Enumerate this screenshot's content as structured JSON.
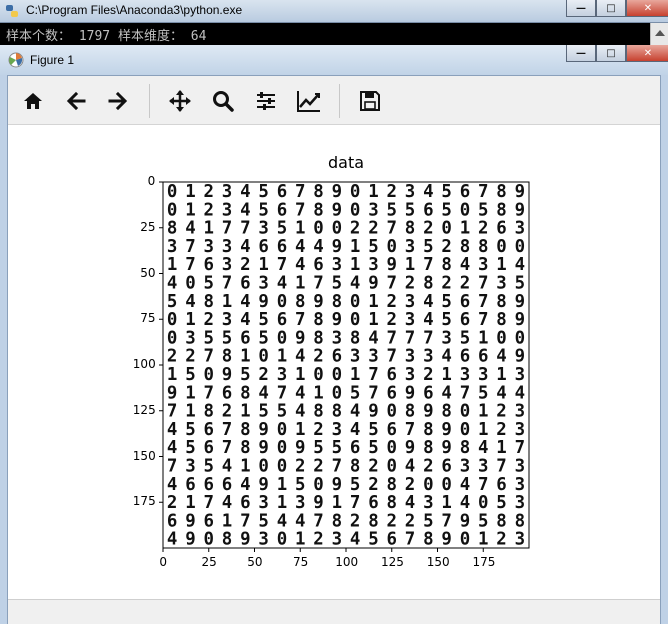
{
  "console": {
    "title": "C:\\Program Files\\Anaconda3\\python.exe",
    "output_line": "样本个数： 1797 样本维度： 64",
    "minimize": "—",
    "maximize": "□",
    "close": "✕"
  },
  "figure": {
    "title": "Figure 1",
    "minimize": "—",
    "maximize": "□",
    "close": "✕",
    "toolbar": [
      "home-icon",
      "back-icon",
      "forward-icon",
      "pan-icon",
      "zoom-icon",
      "configure-subplots-icon",
      "edit-axis-icon",
      "save-icon"
    ]
  },
  "chart_data": {
    "type": "heatmap",
    "title": "data",
    "xlabel": "",
    "ylabel": "",
    "xlim": [
      0,
      200
    ],
    "ylim": [
      200,
      0
    ],
    "xticks": [
      "0",
      "25",
      "50",
      "75",
      "100",
      "125",
      "150",
      "175"
    ],
    "yticks": [
      "0",
      "25",
      "50",
      "75",
      "100",
      "125",
      "150",
      "175"
    ],
    "grid": false,
    "description_cells": 20,
    "digit_rows": [
      "01234567890123456789",
      "01234567890355650589",
      "84177351002278201263",
      "37334664491503528800",
      "17632174631391784314",
      "40576341754972822735",
      "54814908980123456789",
      "01234567890123456789",
      "03556509838477735100",
      "22781014263373346649",
      "15095231001763213313",
      "91768474105769647544",
      "71821554884908980123",
      "45678901234567890123",
      "45678909556509898417",
      "73541002278204263373",
      "46664915095282004763",
      "21746313917684314053",
      "69617544782822579588",
      "49089301234567890123"
    ]
  }
}
